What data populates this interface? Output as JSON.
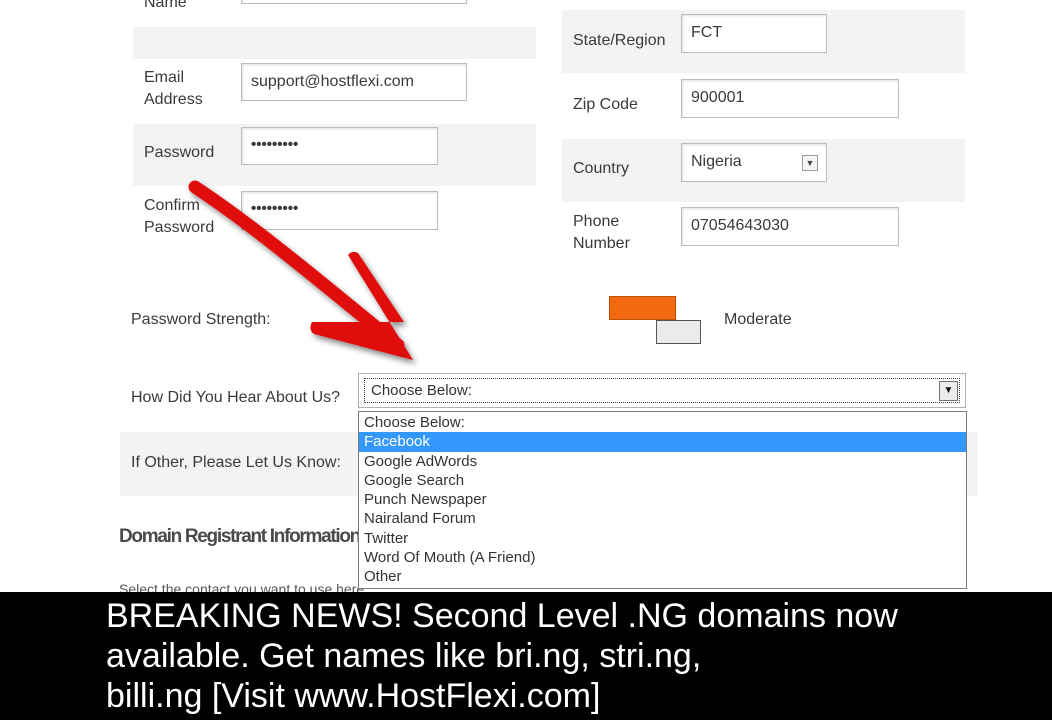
{
  "form": {
    "name_label": "Name",
    "email_label": "Email\nAddress",
    "email_value": "support@hostflexi.com",
    "password_label": "Password",
    "password_value": "•••••••••",
    "confirm_label": "Confirm\nPassword",
    "confirm_value": "•••••••••",
    "state_label": "State/Region",
    "state_value": "FCT",
    "zip_label": "Zip Code",
    "zip_value": "900001",
    "country_label": "Country",
    "country_value": "Nigeria",
    "phone_label": "Phone\nNumber",
    "phone_value": "07054643030",
    "strength_label": "Password Strength:",
    "strength_value": "Moderate",
    "hear_label": "How Did You Hear About Us?",
    "hear_value": "Choose Below:",
    "other_label": "If Other, Please Let Us Know:"
  },
  "dropdown": {
    "options": [
      "Choose Below:",
      "Facebook",
      "Google AdWords",
      "Google Search",
      "Punch Newspaper",
      "Nairaland Forum",
      "Twitter",
      "Word Of Mouth (A Friend)",
      "Other"
    ],
    "highlighted": "Facebook"
  },
  "domain_section": {
    "title": "Domain Registrant Information",
    "subtitle": "Select the contact you want to use here"
  },
  "ticker": {
    "line1": "BREAKING NEWS! Second Level .NG domains now",
    "line2": "available. Get names like bri.ng, stri.ng,",
    "line3": "billi.ng [Visit www.HostFlexi.com]"
  },
  "colors": {
    "strength_bar": "#f26a10",
    "highlight": "#3399ff",
    "annotation_arrow": "#e01010",
    "ticker_bg": "#000000"
  },
  "icons": {
    "arrow": "red-annotation-arrow-icon",
    "select": "chevron-down-icon"
  }
}
